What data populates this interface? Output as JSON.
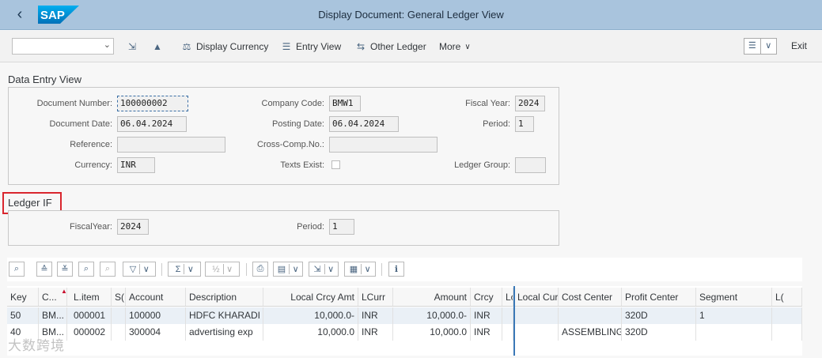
{
  "title_bar": {
    "back_icon": "chevron-left-icon",
    "logo_text": "SAP",
    "title": "Display Document: General Ledger View"
  },
  "toolbar": {
    "command_value": "",
    "display_currency": "Display Currency",
    "entry_view": "Entry View",
    "other_ledger": "Other Ledger",
    "more": "More",
    "exit": "Exit"
  },
  "data_entry": {
    "section_title": "Data Entry View",
    "document_number_label": "Document Number:",
    "document_number": "100000002",
    "company_code_label": "Company Code:",
    "company_code": "BMW1",
    "fiscal_year_label": "Fiscal Year:",
    "fiscal_year": "2024",
    "document_date_label": "Document Date:",
    "document_date": "06.04.2024",
    "posting_date_label": "Posting Date:",
    "posting_date": "06.04.2024",
    "period_label": "Period:",
    "period": "1",
    "reference_label": "Reference:",
    "reference": "",
    "cross_comp_label": "Cross-Comp.No.:",
    "cross_comp": "",
    "currency_label": "Currency:",
    "currency": "INR",
    "texts_exist_label": "Texts Exist:",
    "texts_exist": false,
    "ledger_group_label": "Ledger Group:",
    "ledger_group": ""
  },
  "ledger": {
    "section_title": "Ledger IF",
    "fiscal_year_label": "FiscalYear:",
    "fiscal_year": "2024",
    "period_label": "Period:",
    "period": "1"
  },
  "table": {
    "columns": [
      "Key",
      "C...",
      "L.item",
      "S(",
      "Account",
      "Description",
      "Local Crcy Amt",
      "LCurr",
      "Amount",
      "Crcy",
      "Lc",
      "Local Curr",
      "Cost Center",
      "Profit Center",
      "Segment",
      "L("
    ],
    "rows": [
      [
        "50",
        "BM...",
        "000001",
        "",
        "100000",
        "HDFC KHARADI",
        "10,000.0-",
        "INR",
        "10,000.0-",
        "INR",
        "",
        "",
        "",
        "320D",
        "1",
        ""
      ],
      [
        "40",
        "BM...",
        "000002",
        "",
        "300004",
        "advertising exp",
        "10,000.0",
        "INR",
        "10,000.0",
        "INR",
        "",
        "",
        "ASSEMBLING",
        "320D",
        "",
        ""
      ]
    ]
  },
  "watermark": "大数跨境",
  "colors": {
    "title_bar": "#a9c4dd",
    "highlight": "#d9262e",
    "selected_row": "#eaf0f6"
  }
}
